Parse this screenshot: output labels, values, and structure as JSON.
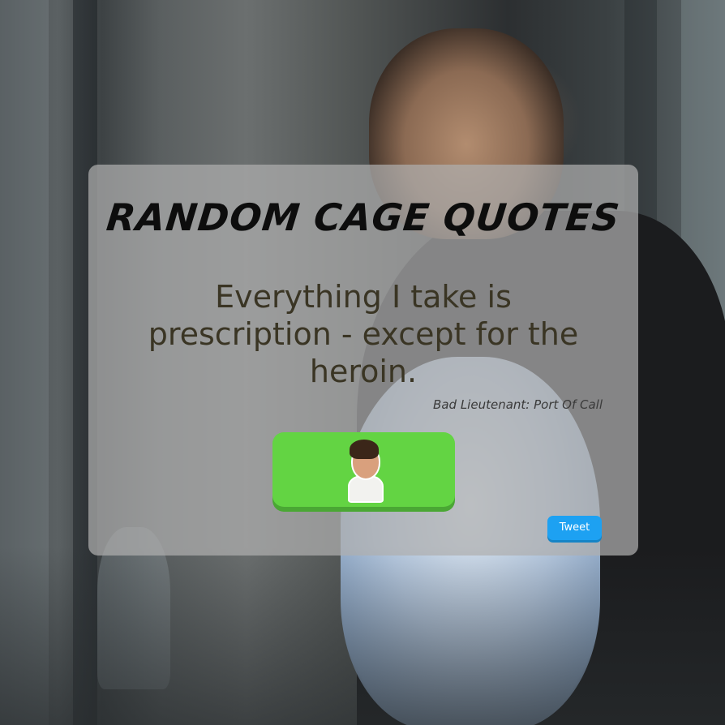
{
  "page": {
    "title": "RANDOM CAGE QUOTES"
  },
  "quote": {
    "text": "Everything I take is prescription - except for the heroin.",
    "source": "Bad Lieutenant: Port Of Call"
  },
  "buttons": {
    "new_quote_icon": "nicolas-cage-face-icon",
    "tweet_label": "Tweet"
  },
  "colors": {
    "card_background": "#afafaf",
    "new_quote_button": "#63d443",
    "tweet_button": "#1da1f2",
    "quote_text": "#3a3524",
    "title_text": "#0d0d0d"
  }
}
